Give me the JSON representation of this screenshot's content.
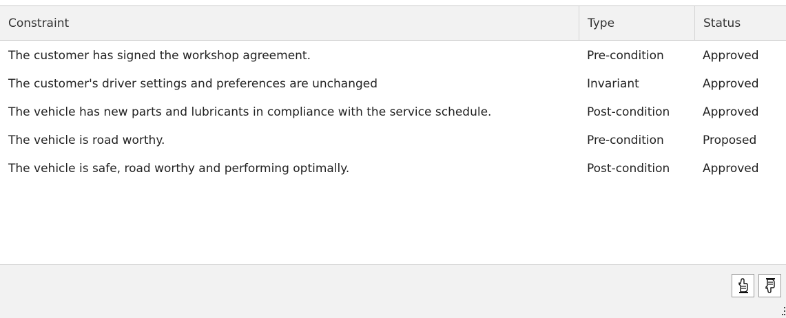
{
  "table": {
    "columns": {
      "constraint": "Constraint",
      "type": "Type",
      "status": "Status"
    },
    "rows": [
      {
        "constraint": "The customer has signed the workshop agreement.",
        "type": "Pre-condition",
        "status": "Approved"
      },
      {
        "constraint": "The customer's driver settings and preferences are unchanged",
        "type": "Invariant",
        "status": "Approved"
      },
      {
        "constraint": "The vehicle has new parts and lubricants in compliance with the service schedule.",
        "type": "Post-condition",
        "status": "Approved"
      },
      {
        "constraint": "The vehicle is road worthy.",
        "type": "Pre-condition",
        "status": "Proposed"
      },
      {
        "constraint": "The vehicle is safe, road worthy and performing optimally.",
        "type": "Post-condition",
        "status": "Approved"
      }
    ]
  },
  "footer": {
    "buttons": [
      {
        "icon": "hand-up-icon"
      },
      {
        "icon": "hand-down-icon"
      }
    ]
  },
  "colors": {
    "header_background": "#f2f2f2",
    "footer_background": "#f2f2f2",
    "border": "#c8c8c8",
    "text": "#222222"
  }
}
